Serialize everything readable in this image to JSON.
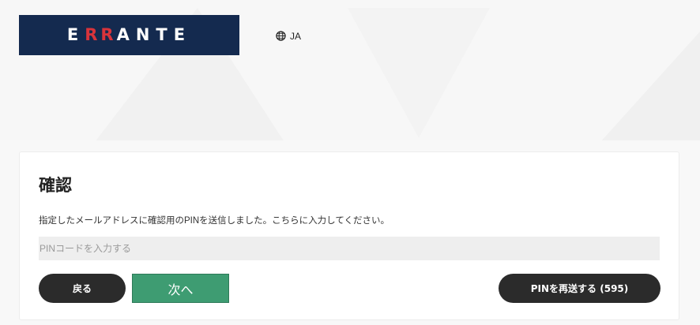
{
  "header": {
    "logo": {
      "prefix": "E",
      "rr": "RR",
      "suffix": "ANTE"
    },
    "language": {
      "label": "JA",
      "icon": "globe-icon"
    }
  },
  "verify": {
    "title": "確認",
    "description": "指定したメールアドレスに確認用のPINを送信しました。こちらに入力してください。",
    "pin_placeholder": "PINコードを入力する",
    "pin_value": "",
    "back_label": "戻る",
    "next_label": "次へ",
    "resend_label": "PINを再送する (595)"
  },
  "colors": {
    "logo_bg": "#142a4f",
    "logo_accent": "#d9343b",
    "dark_button": "#2b2b2b",
    "next_button": "#3e9c72"
  }
}
